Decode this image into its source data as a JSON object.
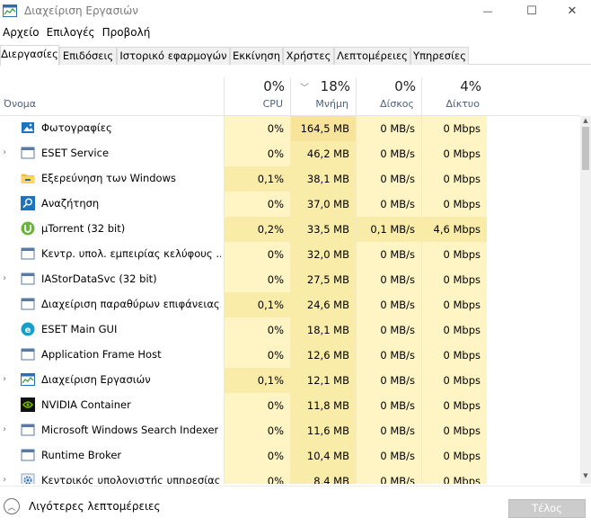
{
  "window": {
    "title": "Διαχείριση Εργασιών",
    "minimize_glyph": "—",
    "maximize_glyph": "☐",
    "close_glyph": "✕"
  },
  "menu": [
    "Αρχείο",
    "Επιλογές",
    "Προβολή"
  ],
  "tabs": [
    {
      "label": "Διεργασίες",
      "active": true
    },
    {
      "label": "Επιδόσεις",
      "active": false
    },
    {
      "label": "Ιστορικό εφαρμογών",
      "active": false
    },
    {
      "label": "Εκκίνηση",
      "active": false
    },
    {
      "label": "Χρήστες",
      "active": false
    },
    {
      "label": "Λεπτομέρειες",
      "active": false
    },
    {
      "label": "Υπηρεσίες",
      "active": false
    }
  ],
  "columns": {
    "name": "Όνομα",
    "cpu": {
      "pct": "0%",
      "label": "CPU"
    },
    "memory": {
      "pct": "18%",
      "label": "Μνήμη"
    },
    "disk": {
      "pct": "0%",
      "label": "Δίσκος"
    },
    "network": {
      "pct": "4%",
      "label": "Δίκτυο"
    }
  },
  "processes": [
    {
      "name": "Φωτογραφίες",
      "icon": "photos-icon",
      "expandable": false,
      "cpu": "0%",
      "memory": "164,5 MB",
      "disk": "0 MB/s",
      "network": "0 Mbps"
    },
    {
      "name": "ESET Service",
      "icon": "service-window-icon",
      "expandable": true,
      "cpu": "0%",
      "memory": "46,2 MB",
      "disk": "0 MB/s",
      "network": "0 Mbps"
    },
    {
      "name": "Εξερεύνηση των Windows",
      "icon": "folder-icon",
      "expandable": false,
      "cpu": "0,1%",
      "memory": "38,1 MB",
      "disk": "0 MB/s",
      "network": "0 Mbps"
    },
    {
      "name": "Αναζήτηση",
      "icon": "search-app-icon",
      "expandable": false,
      "cpu": "0%",
      "memory": "37,0 MB",
      "disk": "0 MB/s",
      "network": "0 Mbps"
    },
    {
      "name": "µTorrent (32 bit)",
      "icon": "utorrent-icon",
      "expandable": false,
      "cpu": "0,2%",
      "memory": "33,5 MB",
      "disk": "0,1 MB/s",
      "network": "4,6 Mbps"
    },
    {
      "name": "Κεντρ. υπολ. εμπειρίας κελύφους ...",
      "icon": "service-window-icon",
      "expandable": false,
      "cpu": "0%",
      "memory": "32,0 MB",
      "disk": "0 MB/s",
      "network": "0 Mbps"
    },
    {
      "name": "IAStorDataSvc (32 bit)",
      "icon": "service-window-icon",
      "expandable": true,
      "cpu": "0%",
      "memory": "27,5 MB",
      "disk": "0 MB/s",
      "network": "0 Mbps"
    },
    {
      "name": "Διαχείριση παραθύρων επιφάνειας...",
      "icon": "service-window-icon",
      "expandable": false,
      "cpu": "0,1%",
      "memory": "24,6 MB",
      "disk": "0 MB/s",
      "network": "0 Mbps"
    },
    {
      "name": "ESET Main GUI",
      "icon": "eset-icon",
      "expandable": false,
      "cpu": "0%",
      "memory": "18,1 MB",
      "disk": "0 MB/s",
      "network": "0 Mbps"
    },
    {
      "name": "Application Frame Host",
      "icon": "service-window-icon",
      "expandable": false,
      "cpu": "0%",
      "memory": "12,6 MB",
      "disk": "0 MB/s",
      "network": "0 Mbps"
    },
    {
      "name": "Διαχείριση Εργασιών",
      "icon": "task-manager-icon",
      "expandable": true,
      "cpu": "0,1%",
      "memory": "12,1 MB",
      "disk": "0 MB/s",
      "network": "0 Mbps"
    },
    {
      "name": "NVIDIA Container",
      "icon": "nvidia-icon",
      "expandable": false,
      "cpu": "0%",
      "memory": "11,8 MB",
      "disk": "0 MB/s",
      "network": "0 Mbps"
    },
    {
      "name": "Microsoft Windows Search Indexer",
      "icon": "service-window-icon",
      "expandable": true,
      "cpu": "0%",
      "memory": "11,6 MB",
      "disk": "0 MB/s",
      "network": "0 Mbps"
    },
    {
      "name": "Runtime Broker",
      "icon": "service-window-icon",
      "expandable": false,
      "cpu": "0%",
      "memory": "10,4 MB",
      "disk": "0 MB/s",
      "network": "0 Mbps"
    },
    {
      "name": "Κεντρικός υπολογιστής υπηρεσίας...",
      "icon": "gear-icon",
      "expandable": true,
      "cpu": "0%",
      "memory": "8,4 MB",
      "disk": "0 MB/s",
      "network": "0 Mbps"
    }
  ],
  "footer": {
    "less_details": "Λιγότερες λεπτομέρειες",
    "end_task": "Τέλος εργασίας"
  },
  "colors": {
    "heat_light": "#fff4c4",
    "heat_medium": "#f9eca8",
    "header_label": "#4c607a"
  }
}
